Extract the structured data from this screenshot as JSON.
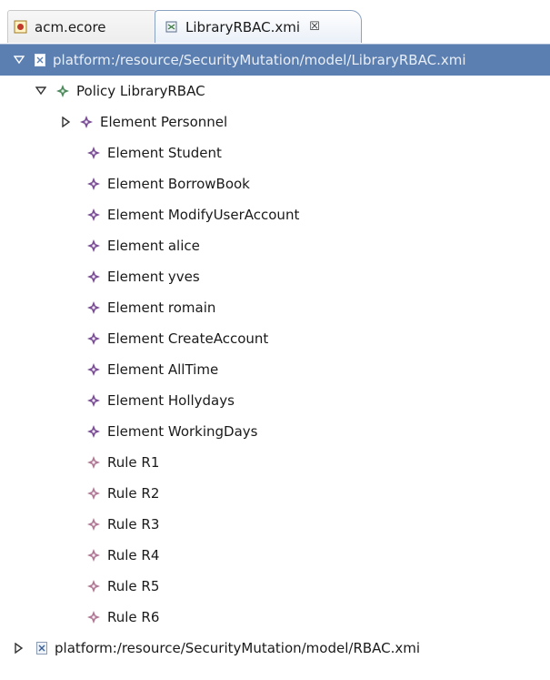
{
  "tabs": [
    {
      "label": "acm.ecore",
      "active": false,
      "icon": "ecore-file-icon"
    },
    {
      "label": "LibraryRBAC.xmi",
      "active": true,
      "icon": "xmi-file-icon",
      "close_glyph": "☒"
    }
  ],
  "tree": {
    "resource1": {
      "label": "platform:/resource/SecurityMutation/model/LibraryRBAC.xmi",
      "expanded": true,
      "selected": true
    },
    "policy": {
      "label": "Policy LibraryRBAC",
      "expanded": true
    },
    "elements": [
      {
        "label": "Element Personnel",
        "has_children": true
      },
      {
        "label": "Element Student"
      },
      {
        "label": "Element BorrowBook"
      },
      {
        "label": "Element ModifyUserAccount"
      },
      {
        "label": "Element alice"
      },
      {
        "label": "Element yves"
      },
      {
        "label": "Element romain"
      },
      {
        "label": "Element CreateAccount"
      },
      {
        "label": "Element AllTime"
      },
      {
        "label": "Element Hollydays"
      },
      {
        "label": "Element WorkingDays"
      }
    ],
    "rules": [
      {
        "label": "Rule R1"
      },
      {
        "label": "Rule R2"
      },
      {
        "label": "Rule R3"
      },
      {
        "label": "Rule R4"
      },
      {
        "label": "Rule R5"
      },
      {
        "label": "Rule R6"
      }
    ],
    "resource2": {
      "label": "platform:/resource/SecurityMutation/model/RBAC.xmi",
      "expanded": false
    }
  },
  "colors": {
    "selection": "#5b7fb0",
    "element_icon": "#7a4f96",
    "rule_icon": "#b07a96",
    "policy_icon": "#4f8a5e"
  }
}
